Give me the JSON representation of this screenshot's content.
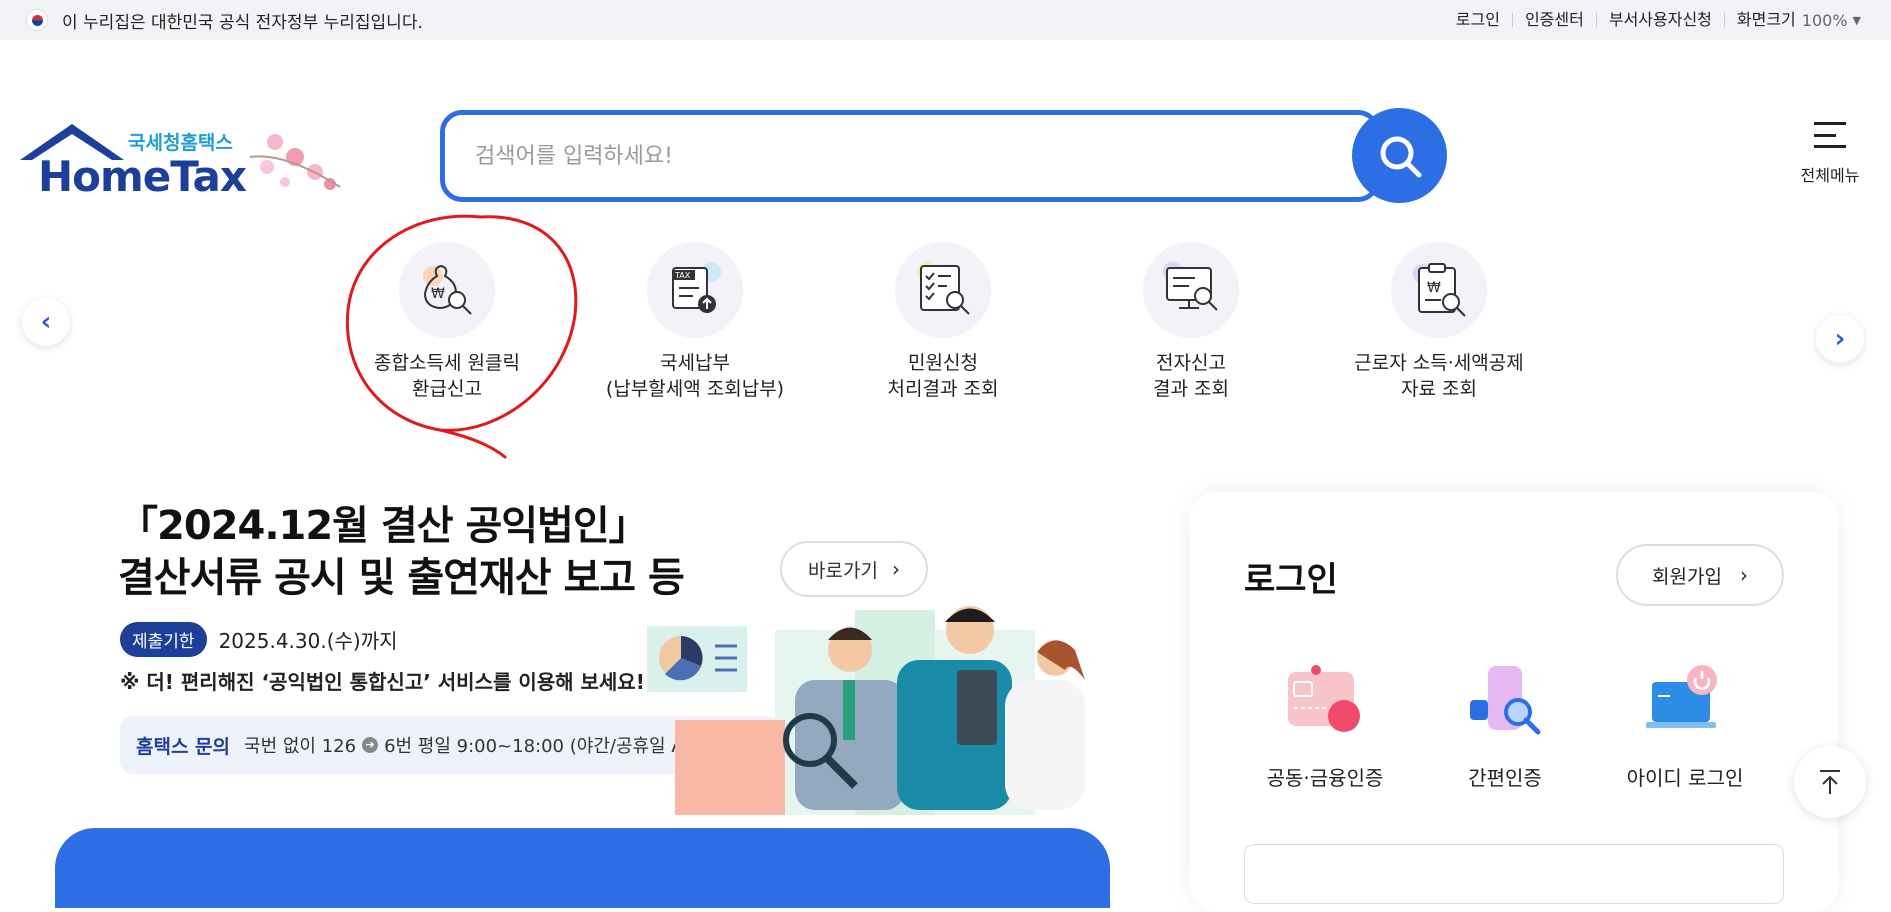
{
  "gov_bar": {
    "notice": "이 누리집은 대한민국 공식 전자정부 누리집입니다.",
    "links": [
      "로그인",
      "인증센터",
      "부서사용자신청",
      "화면크기"
    ],
    "zoom": "100%"
  },
  "header": {
    "logo_sub": "국세청홈택스",
    "logo_main": "HomeTax",
    "search_placeholder": "검색어를 입력하세요!",
    "all_menu_label": "전체메뉴"
  },
  "quick_menu": {
    "items": [
      {
        "line1": "종합소득세 원클릭",
        "line2": "환급신고",
        "icon": "moneybag-search-icon"
      },
      {
        "line1": "국세납부",
        "line2": "(납부할세액 조회납부)",
        "icon": "tax-upload-icon"
      },
      {
        "line1": "민원신청",
        "line2": "처리결과 조회",
        "icon": "checklist-search-icon"
      },
      {
        "line1": "전자신고",
        "line2": "결과 조회",
        "icon": "monitor-search-icon"
      },
      {
        "line1": "근로자 소득·세액공제",
        "line2": "자료 조회",
        "icon": "clipboard-won-search-icon"
      }
    ]
  },
  "banner": {
    "title_line1": "「2024.12월 결산 공익법인」",
    "title_line2": "결산서류 공시 및 출연재산 보고 등",
    "go_label": "바로가기",
    "deadline_badge": "제출기한",
    "deadline_date": "2025.4.30.(수)까지",
    "note": "※ 더! 편리해진 ‘공익법인 통합신고’ 서비스를 이용해 보세요!",
    "inquiry_label": "홈택스 문의",
    "inquiry_text1": "국번 없이 126",
    "inquiry_text2": "6번 평일 9:00~18:00 (야간/공휴일 AI 상담 연결)"
  },
  "login": {
    "title": "로그인",
    "signup_label": "회원가입",
    "options": [
      "공동·금융인증",
      "간편인증",
      "아이디 로그인"
    ]
  },
  "colors": {
    "brand_blue": "#2d6ee5",
    "navy": "#1c3f9a",
    "annotation_red": "#e0191b"
  }
}
